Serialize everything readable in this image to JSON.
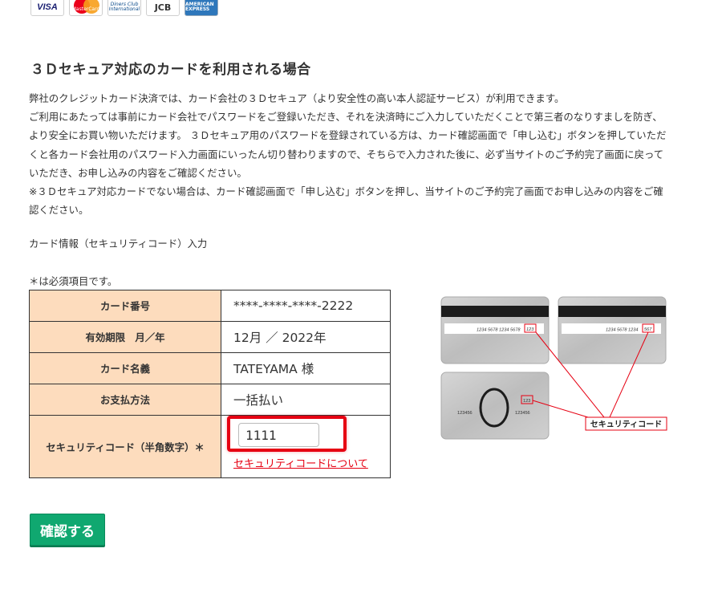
{
  "brands": [
    {
      "name": "visa-logo",
      "text": "VISA"
    },
    {
      "name": "mastercard-logo",
      "text": "MasterCard"
    },
    {
      "name": "diners-logo",
      "text": "Diners Club International"
    },
    {
      "name": "jcb-logo",
      "text": "JCB"
    },
    {
      "name": "amex-logo",
      "text": "AMERICAN EXPRESS"
    }
  ],
  "heading": "３Ｄセキュア対応のカードを利用される場合",
  "description": [
    "弊社のクレジットカード決済では、カード会社の３Ｄセキュア（より安全性の高い本人認証サービス）が利用できます。",
    "ご利用にあたっては事前にカード会社でパスワードをご登録いただき、それを決済時にご入力していただくことで第三者のなりすましを防ぎ、より安全にお買い物いただけます。 ３Ｄセキュア用のパスワードを登録されている方は、カード確認画面で「申し込む」ボタンを押していただくと各カード会社用のパスワード入力画面にいったん切り替わりますので、そちらで入力された後に、必ず当サイトのご予約完了画面に戻っていただき、お申し込みの内容をご確認ください。",
    "※３Ｄセキュア対応カードでない場合は、カード確認画面で「申し込む」ボタンを押し、当サイトのご予約完了画面でお申し込みの内容をご確認ください。"
  ],
  "section_label": "カード情報（セキュリティコード）入力",
  "required_note": "＊は必須項目です。",
  "table": {
    "rows": [
      {
        "label": "カード番号",
        "value": "****-****-****-2222"
      },
      {
        "label": "有効期限　月／年",
        "value": "12月 ／ 2022年"
      },
      {
        "label": "カード名義",
        "value": "TATEYAMA 様"
      },
      {
        "label": "お支払方法",
        "value": "一括払い"
      }
    ],
    "security_label": "セキュリティコード（半角数字）＊",
    "security_value": "1111",
    "security_link": "セキュリティコードについて"
  },
  "diagram": {
    "card1_number": "1234 5678 1234 5678",
    "card1_code": "123",
    "card2_number": "1234 5678 1234",
    "card2_code": "567",
    "card3_left": "123456",
    "card3_right": "123456",
    "card3_code": "123",
    "callout": "セキュリティコード"
  },
  "confirm_button": "確認する",
  "colors": {
    "header_bg": "#fddcbd",
    "highlight": "#e60012",
    "button": "#10a870",
    "link": "#e60012"
  }
}
